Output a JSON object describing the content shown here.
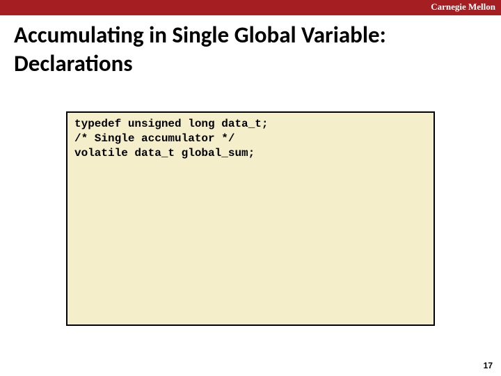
{
  "header": {
    "institution": "Carnegie Mellon"
  },
  "slide": {
    "title": "Accumulating in Single Global Variable: Declarations"
  },
  "code": {
    "lines": [
      "typedef unsigned long data_t;",
      "/* Single accumulator */",
      "volatile data_t global_sum;"
    ]
  },
  "footer": {
    "page_number": "17"
  }
}
